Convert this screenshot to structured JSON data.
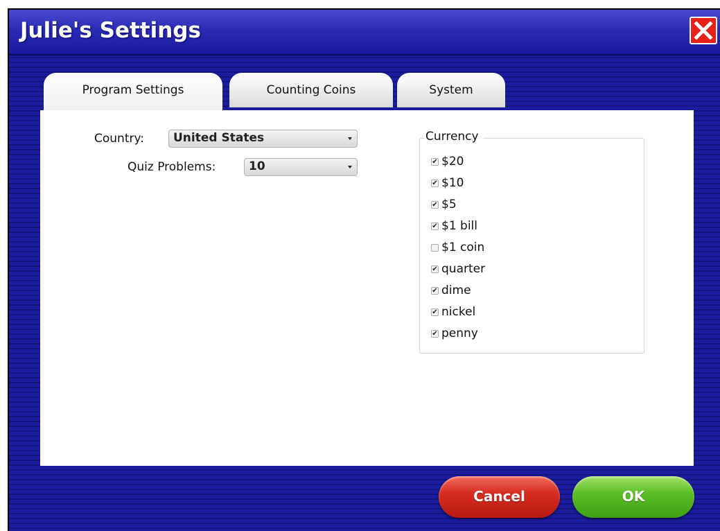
{
  "window": {
    "title": "Julie's Settings"
  },
  "tabs": [
    {
      "label": "Program Settings",
      "active": true
    },
    {
      "label": "Counting Coins",
      "active": false
    },
    {
      "label": "System",
      "active": false
    }
  ],
  "settings": {
    "country_label": "Country:",
    "country_value": "United States",
    "quiz_label": "Quiz Problems:",
    "quiz_value": "10"
  },
  "currency": {
    "legend": "Currency",
    "items": [
      {
        "label": "$20",
        "checked": true
      },
      {
        "label": "$10",
        "checked": true
      },
      {
        "label": "$5",
        "checked": true
      },
      {
        "label": "$1 bill",
        "checked": true
      },
      {
        "label": "$1 coin",
        "checked": false
      },
      {
        "label": "quarter",
        "checked": true
      },
      {
        "label": "dime",
        "checked": true
      },
      {
        "label": "nickel",
        "checked": true
      },
      {
        "label": "penny",
        "checked": true
      }
    ]
  },
  "buttons": {
    "cancel": "Cancel",
    "ok": "OK"
  },
  "colors": {
    "background": "#1a1a96",
    "cancel": "#d62d20",
    "ok": "#5cbf26",
    "close": "#e8211b"
  }
}
